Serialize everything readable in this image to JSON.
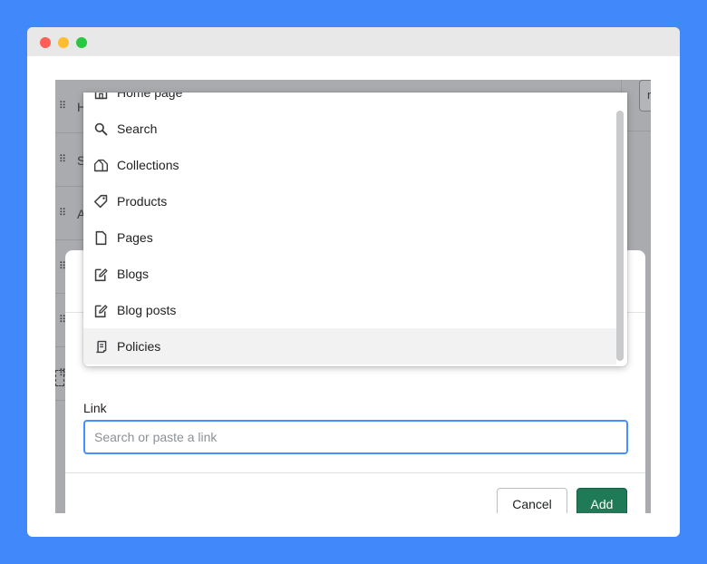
{
  "background": {
    "rows": [
      {
        "text": "H"
      },
      {
        "text": "S"
      },
      {
        "text": "A"
      },
      {
        "text": ""
      },
      {
        "text": ""
      }
    ],
    "chip_text": "r"
  },
  "dropdown": {
    "items": [
      {
        "label": "Home page",
        "icon": "home-icon"
      },
      {
        "label": "Search",
        "icon": "search-icon"
      },
      {
        "label": "Collections",
        "icon": "collections-icon"
      },
      {
        "label": "Products",
        "icon": "tag-icon"
      },
      {
        "label": "Pages",
        "icon": "page-icon"
      },
      {
        "label": "Blogs",
        "icon": "blog-edit-icon"
      },
      {
        "label": "Blog posts",
        "icon": "blog-post-edit-icon"
      },
      {
        "label": "Policies",
        "icon": "policy-scroll-icon"
      }
    ],
    "highlighted_item": "Policies"
  },
  "modal": {
    "link_label": "Link",
    "link_placeholder": "Search or paste a link",
    "link_value": "",
    "cancel_label": "Cancel",
    "add_label": "Add"
  },
  "colors": {
    "page_background": "#4189fb",
    "primary_button": "#1f7a57",
    "input_focus_border": "#458fff"
  }
}
